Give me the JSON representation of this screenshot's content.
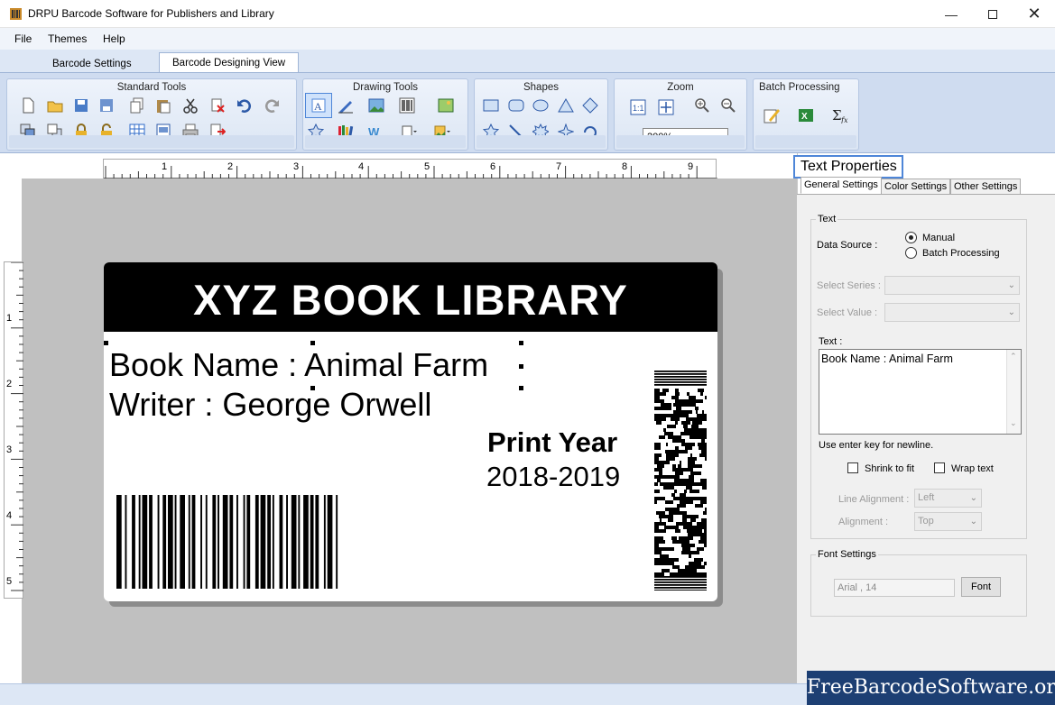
{
  "window": {
    "title": "DRPU Barcode Software for Publishers and Library",
    "minimize_icon": "minimize-icon",
    "maximize_icon": "maximize-icon",
    "close_icon": "close-icon"
  },
  "menu": {
    "items": [
      "File",
      "Themes",
      "Help"
    ]
  },
  "tabs": [
    {
      "label": "Barcode Settings",
      "active": false
    },
    {
      "label": "Barcode Designing View",
      "active": true
    }
  ],
  "ribbon": {
    "groups": {
      "standard": "Standard Tools",
      "drawing": "Drawing Tools",
      "shapes": "Shapes",
      "zoom": "Zoom",
      "batch": "Batch Processing"
    },
    "zoom_value": "200%"
  },
  "rulers": {
    "horizontal": [
      "1",
      "2",
      "3",
      "4",
      "5",
      "6",
      "7",
      "8",
      "9"
    ],
    "vertical": [
      "1",
      "2",
      "3",
      "4",
      "5"
    ]
  },
  "label": {
    "title": "XYZ BOOK LIBRARY",
    "line1": "Book Name : Animal Farm",
    "line2": "Writer : George Orwell",
    "print_year_label": "Print Year",
    "print_year_value": "2018-2019"
  },
  "properties": {
    "title": "Text Properties",
    "tabs": [
      "General Settings",
      "Color Settings",
      "Other Settings"
    ],
    "text_group": "Text",
    "data_source_label": "Data Source :",
    "data_source_options": [
      "Manual",
      "Batch Processing"
    ],
    "data_source_selected": "Manual",
    "select_series_label": "Select Series :",
    "select_value_label": "Select Value :",
    "text_label": "Text :",
    "text_value": "Book Name : Animal Farm",
    "hint": "Use enter key for newline.",
    "shrink_to_fit": "Shrink to fit",
    "wrap_text": "Wrap text",
    "line_alignment_label": "Line Alignment :",
    "line_alignment_value": "Left",
    "alignment_label": "Alignment :",
    "alignment_value": "Top",
    "font_group": "Font Settings",
    "font_value": "Arial , 14",
    "font_button": "Font"
  },
  "watermark": "FreeBarcodeSoftware.org",
  "colors": {
    "ribbon_bg": "#cfdcf0",
    "selection_border": "#4e86d8",
    "label_header": "#000000",
    "watermark_bg": "#1d3f73"
  }
}
